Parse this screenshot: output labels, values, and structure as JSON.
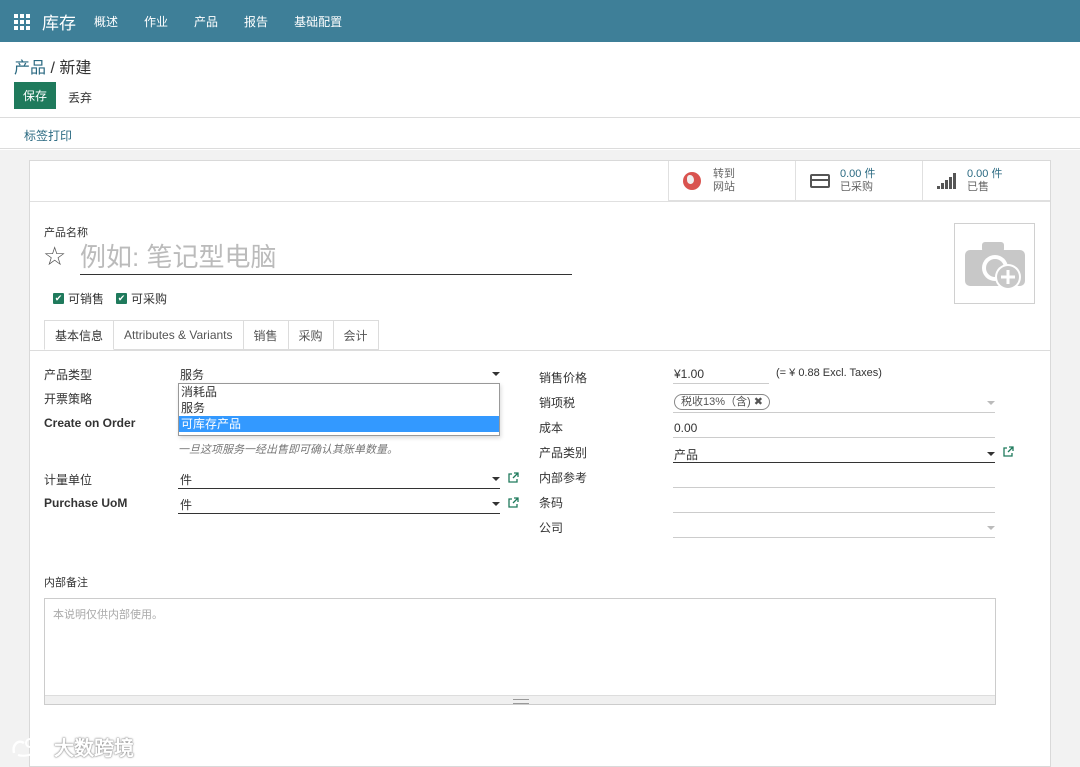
{
  "navbar": {
    "brand": "库存",
    "items": [
      "概述",
      "作业",
      "产品",
      "报告",
      "基础配置"
    ]
  },
  "breadcrumb": {
    "parent": "产品",
    "separator": " / ",
    "current": "新建"
  },
  "toolbar": {
    "save_label": "保存",
    "discard_label": "丢弃"
  },
  "status": {
    "print_label": "标签打印"
  },
  "smart_buttons": {
    "website": {
      "line1": "转到",
      "line2": "网站"
    },
    "purchased": {
      "value": "0.00 件",
      "label": "已采购"
    },
    "sold": {
      "value": "0.00 件",
      "label": "已售"
    }
  },
  "product": {
    "name_label": "产品名称",
    "name_placeholder": "例如: 笔记型电脑",
    "can_be_sold": "可销售",
    "can_be_purchased": "可采购"
  },
  "tabs": [
    "基本信息",
    "Attributes & Variants",
    "销售",
    "采购",
    "会计"
  ],
  "left_fields": {
    "type_label": "产品类型",
    "type_value": "服务",
    "invoice_policy_label": "开票策略",
    "create_on_order_label": "Create on Order",
    "type_options": [
      "消耗品",
      "服务",
      "可库存产品"
    ],
    "type_hint": "一旦这项服务一经出售即可确认其账单数量。",
    "uom_label": "计量单位",
    "uom_value": "件",
    "purchase_uom_label": "Purchase UoM",
    "purchase_uom_value": "件"
  },
  "right_fields": {
    "sale_price_label": "销售价格",
    "sale_price_value": "¥1.00",
    "sale_price_excl": "(= ¥ 0.88 Excl. Taxes)",
    "tax_label": "销项税",
    "tax_tag": "税收13%（含)",
    "cost_label": "成本",
    "cost_value": "0.00",
    "category_label": "产品类别",
    "category_value": "产品",
    "internal_ref_label": "内部参考",
    "barcode_label": "条码",
    "company_label": "公司"
  },
  "notes": {
    "label": "内部备注",
    "placeholder": "本说明仅供内部使用。"
  },
  "watermark": {
    "text": "大数跨境"
  }
}
